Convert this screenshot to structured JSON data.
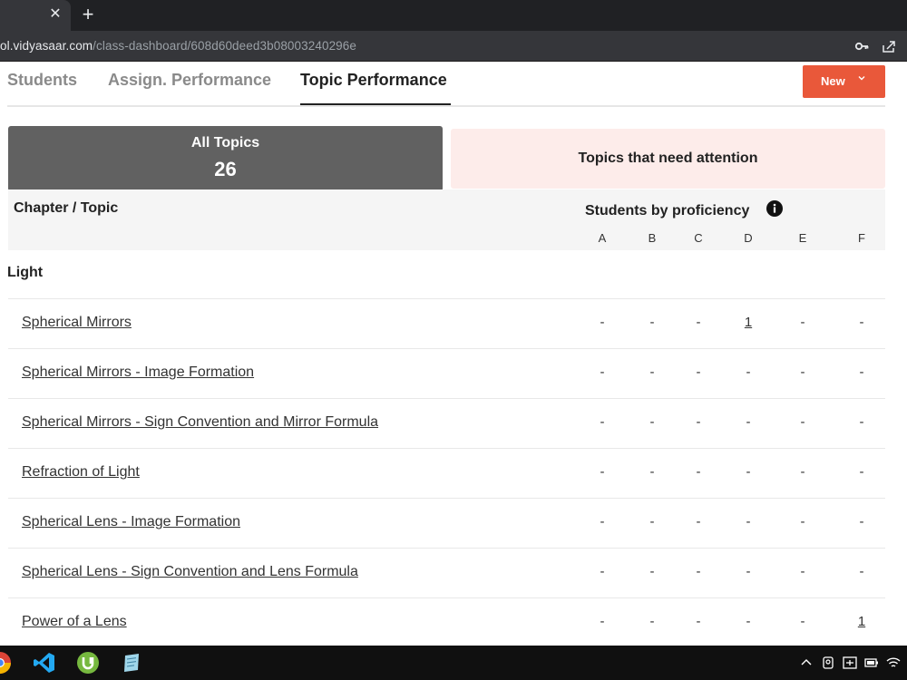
{
  "browser": {
    "url_host": "ol.vidyasaar.com",
    "url_path": "/class-dashboard/608d60deed3b08003240296e",
    "close_tab_glyph": "✕",
    "new_tab_glyph": "+"
  },
  "tabs": [
    {
      "label": "Students",
      "active": false
    },
    {
      "label": "Assign. Performance",
      "active": false
    },
    {
      "label": "Topic Performance",
      "active": true
    }
  ],
  "new_button": {
    "label": "New"
  },
  "all_topics": {
    "label": "All Topics",
    "count": "26"
  },
  "attention": {
    "label": "Topics that need attention"
  },
  "table": {
    "col_topic": "Chapter / Topic",
    "col_proficiency": "Students by proficiency",
    "grades": [
      "A",
      "B",
      "C",
      "D",
      "E",
      "F"
    ],
    "chapter": "Light",
    "rows": [
      {
        "topic": "Spherical Mirrors",
        "values": [
          "-",
          "-",
          "-",
          "1",
          "-",
          "-"
        ]
      },
      {
        "topic": "Spherical Mirrors - Image Formation",
        "values": [
          "-",
          "-",
          "-",
          "-",
          "-",
          "-"
        ]
      },
      {
        "topic": "Spherical Mirrors - Sign Convention and Mirror Formula",
        "values": [
          "-",
          "-",
          "-",
          "-",
          "-",
          "-"
        ]
      },
      {
        "topic": "Refraction of Light",
        "values": [
          "-",
          "-",
          "-",
          "-",
          "-",
          "-"
        ]
      },
      {
        "topic": "Spherical Lens - Image Formation",
        "values": [
          "-",
          "-",
          "-",
          "-",
          "-",
          "-"
        ]
      },
      {
        "topic": "Spherical Lens - Sign Convention and Lens Formula",
        "values": [
          "-",
          "-",
          "-",
          "-",
          "-",
          "-"
        ]
      },
      {
        "topic": "Power of a Lens",
        "values": [
          "-",
          "-",
          "-",
          "-",
          "-",
          "1"
        ]
      }
    ]
  },
  "colors": {
    "accent": "#e9583a",
    "active_card": "#616161",
    "attention_card": "#fdecea",
    "header_bg": "#f5f5f5"
  },
  "taskbar": {
    "apps": [
      "chrome-icon",
      "vscode-icon",
      "utorrent-icon",
      "notepad-icon"
    ],
    "tray": [
      "chevron-up-icon",
      "meet-now-icon",
      "defender-icon",
      "battery-icon",
      "wifi-icon"
    ]
  }
}
